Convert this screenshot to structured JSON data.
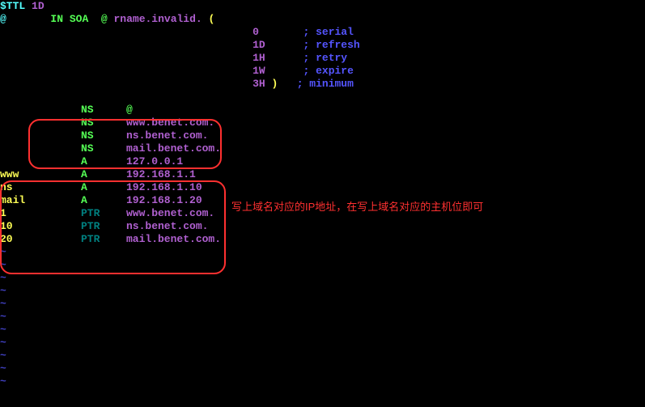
{
  "header": {
    "ttl_key": "$TTL",
    "ttl_val": "1D",
    "soa_at1": "@",
    "soa_in": "IN",
    "soa_type": "SOA",
    "soa_at2": "@",
    "soa_admin": "rname.invalid.",
    "soa_lparen": "("
  },
  "soa_params": [
    {
      "val": "0",
      "br": "",
      "comment": "; serial"
    },
    {
      "val": "1D",
      "br": "",
      "comment": "; refresh"
    },
    {
      "val": "1H",
      "br": "",
      "comment": "; retry"
    },
    {
      "val": "1W",
      "br": "",
      "comment": "; expire"
    },
    {
      "val": "3H",
      "br": ")",
      "comment": "; minimum"
    }
  ],
  "records": [
    {
      "label": "",
      "type": "NS",
      "value": "@",
      "color_type": "green",
      "color_value": "green"
    },
    {
      "label": "",
      "type": "NS",
      "value": "www.benet.com.",
      "color_type": "green",
      "color_value": "purple"
    },
    {
      "label": "",
      "type": "NS",
      "value": "ns.benet.com.",
      "color_type": "green",
      "color_value": "purple"
    },
    {
      "label": "",
      "type": "NS",
      "value": "mail.benet.com.",
      "color_type": "green",
      "color_value": "purple"
    },
    {
      "label": "",
      "type": "A",
      "value": "127.0.0.1",
      "color_type": "green",
      "color_value": "purple"
    },
    {
      "label": "www",
      "type": "A",
      "value": "192.168.1.1",
      "color_type": "green",
      "color_value": "purple"
    },
    {
      "label": "ns",
      "type": "A",
      "value": "192.168.1.10",
      "color_type": "green",
      "color_value": "purple"
    },
    {
      "label": "mail",
      "type": "A",
      "value": "192.168.1.20",
      "color_type": "green",
      "color_value": "purple"
    },
    {
      "label": "1",
      "type": "PTR",
      "value": "www.benet.com.",
      "color_type": "teal",
      "color_value": "purple"
    },
    {
      "label": "10",
      "type": "PTR",
      "value": "ns.benet.com.",
      "color_type": "teal",
      "color_value": "purple"
    },
    {
      "label": "20",
      "type": "PTR",
      "value": "mail.benet.com.",
      "color_type": "teal",
      "color_value": "purple"
    }
  ],
  "annotation": "写上域名对应的IP地址，在写上域名对应的主机位即可",
  "tilde": "~"
}
